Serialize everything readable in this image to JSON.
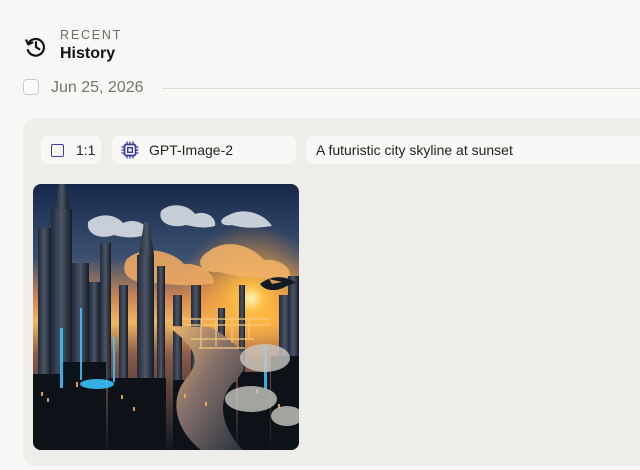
{
  "header": {
    "eyebrow": "RECENT",
    "title": "History",
    "icon": "history-icon"
  },
  "date_group": {
    "label": "Jun 25, 2026",
    "selected": false
  },
  "generation": {
    "aspect_ratio": "1:1",
    "model": "GPT-Image-2",
    "prompt": "A futuristic city skyline at sunset",
    "image_description_icon": "generated-image"
  },
  "colors": {
    "accent": "#3a3aa8",
    "page_background": "#f8f7f5",
    "panel_background": "#eeede9"
  }
}
